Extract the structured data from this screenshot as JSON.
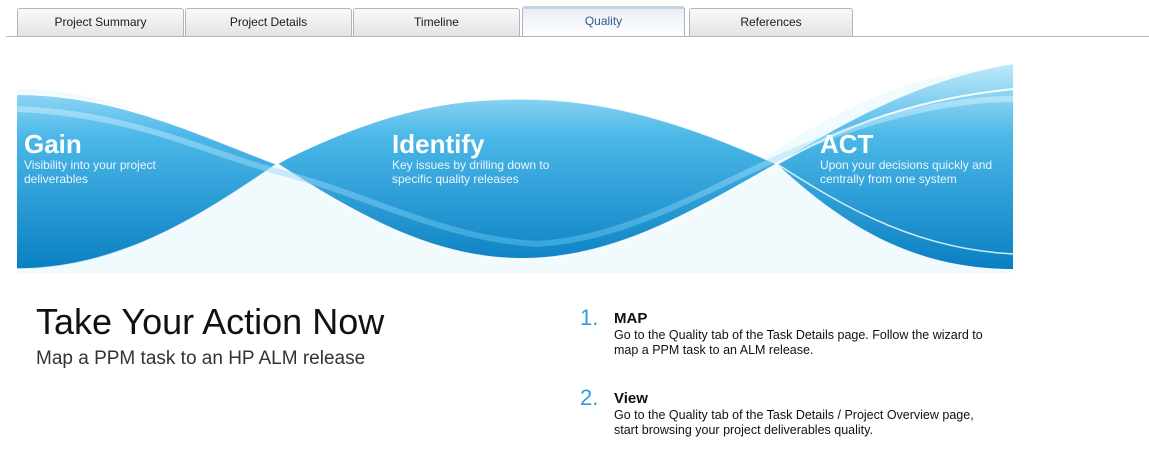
{
  "tabs": [
    {
      "label": "Project Summary"
    },
    {
      "label": "Project Details"
    },
    {
      "label": "Timeline"
    },
    {
      "label": "Quality",
      "active": true
    },
    {
      "label": "References"
    }
  ],
  "banner": {
    "colors": {
      "dark": "#0a7fc2",
      "mid": "#2a9fd8",
      "light": "#8fd6f5"
    },
    "sections": [
      {
        "title": "Gain",
        "subtitle": "Visibility into your project deliverables"
      },
      {
        "title": "Identify",
        "subtitle": "Key issues by drilling down to specific quality releases"
      },
      {
        "title": "ACT",
        "subtitle": "Upon your decisions quickly and centrally from one system"
      }
    ]
  },
  "main": {
    "headline": "Take Your Action Now",
    "subheadline": "Map a PPM task to an HP ALM release"
  },
  "steps": [
    {
      "number": "1.",
      "title": "MAP",
      "description": "Go to the Quality tab of the Task Details page. Follow the wizard to map a PPM task to an ALM release."
    },
    {
      "number": "2.",
      "title": "View",
      "description": "Go to the Quality tab of the Task Details / Project Overview page, start browsing your project deliverables quality."
    }
  ]
}
